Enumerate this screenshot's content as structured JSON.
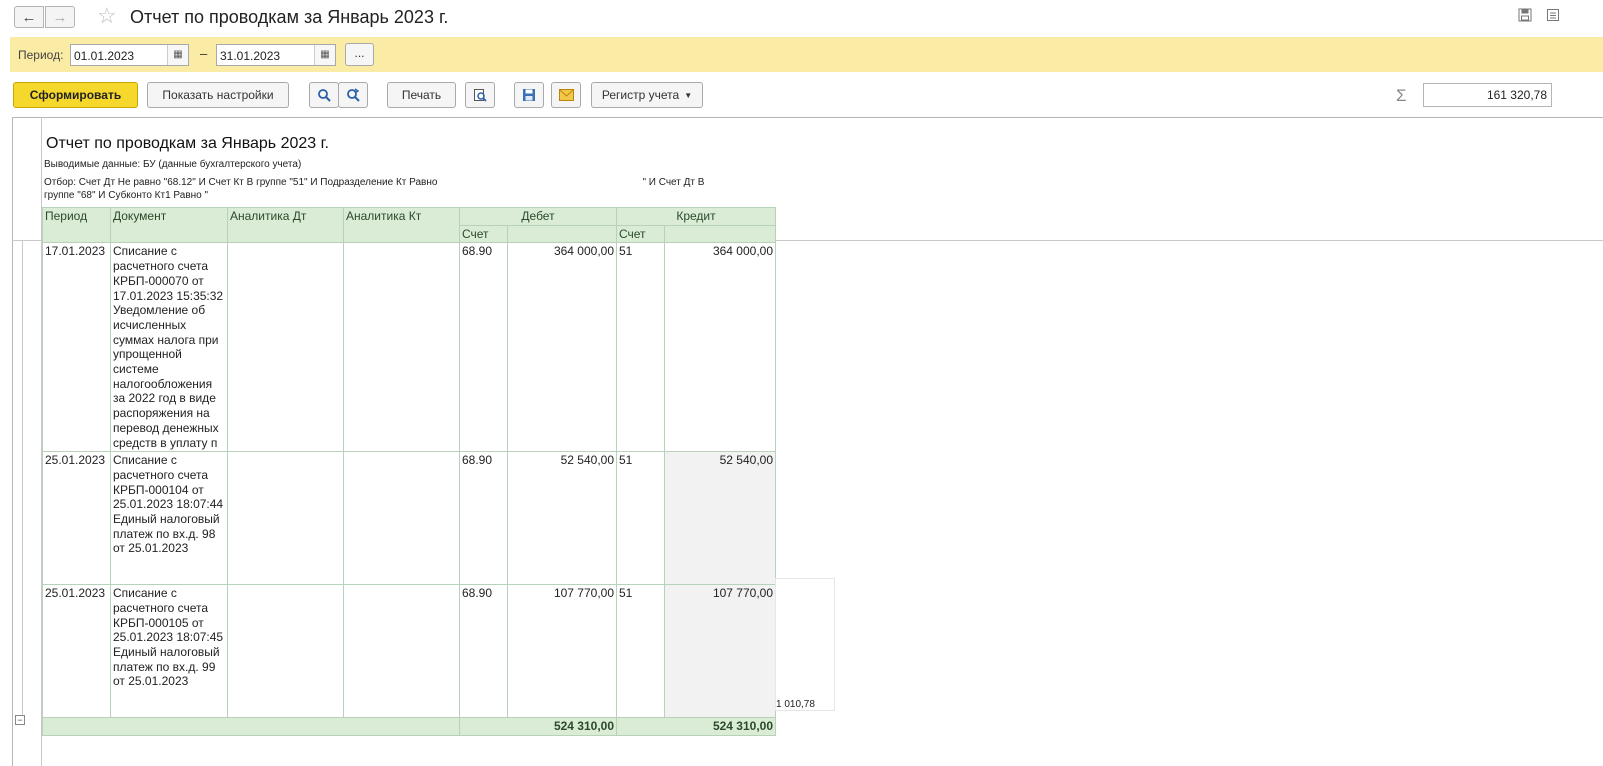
{
  "window": {
    "title": "Отчет по проводкам за Январь 2023 г.",
    "back_icon": "arrow-left-icon",
    "forward_icon": "arrow-right-icon",
    "favorite_icon": "star-icon",
    "save_icon": "floppy-icon",
    "more_icon": "more-icon"
  },
  "period": {
    "label": "Период:",
    "from": "01.01.2023",
    "to": "31.01.2023",
    "dash": "–",
    "select_label": "..."
  },
  "toolbar": {
    "generate_label": "Сформировать",
    "settings_label": "Показать настройки",
    "print_label": "Печать",
    "register_label": "Регистр учета",
    "sum_value": "161 320,78",
    "sigma": "Σ"
  },
  "report": {
    "title": "Отчет по проводкам за Январь 2023 г.",
    "output": "Выводимые данные:  БУ (данные бухгалтерского учета)",
    "filter_line1": "Отбор: Счет Дт Не равно \"68.12\" И Счет Кт В группе \"51\" И Подразделение Кт Равно",
    "filter_line1_end": "\" И Счет Дт В",
    "filter_line2": "группе \"68\" И Субконто Кт1 Равно \"",
    "headers": {
      "period": "Период",
      "document": "Документ",
      "analytics_dt": "Аналитика Дт",
      "analytics_kt": "Аналитика Кт",
      "debit": "Дебет",
      "credit": "Кредит",
      "account": "Счет"
    },
    "rows": [
      {
        "period": "17.01.2023",
        "document": "Списание с расчетного счета КРБП-000070 от 17.01.2023 15:35:32 Уведомление об исчисленных суммах налога при упрощенной системе налогообложения за 2022 год в виде распоряжения на перевод денежных средств в уплату п",
        "dt_account": "68.90",
        "dt_amount": "364 000,00",
        "kt_account": "51",
        "kt_amount": "364 000,00"
      },
      {
        "period": "25.01.2023",
        "document": "Списание с расчетного счета КРБП-000104 от 25.01.2023 18:07:44 Единый налоговый платеж по вх.д. 98 от 25.01.2023",
        "dt_account": "68.90",
        "dt_amount": "52 540,00",
        "kt_account": "51",
        "kt_amount": "52 540,00"
      },
      {
        "period": "25.01.2023",
        "document": "Списание с расчетного счета КРБП-000105 от 25.01.2023 18:07:45 Единый налоговый платеж по вх.д. 99 от 25.01.2023",
        "dt_account": "68.90",
        "dt_amount": "107 770,00",
        "kt_account": "51",
        "kt_amount": "107 770,00"
      }
    ],
    "total_debit": "524 310,00",
    "total_credit": "524 310,00",
    "side_note": "1 010,78"
  }
}
